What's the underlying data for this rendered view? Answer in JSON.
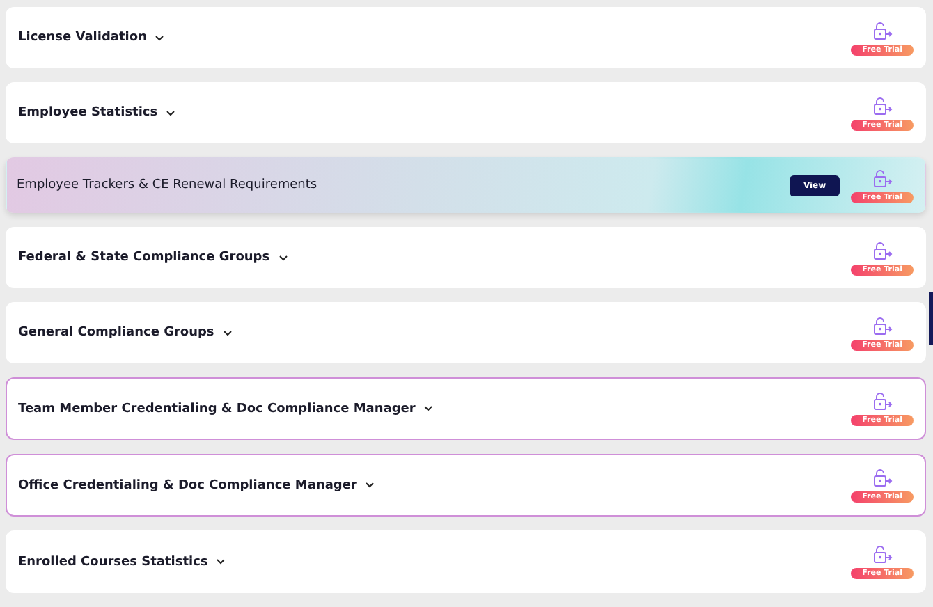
{
  "sections": [
    {
      "kind": "accordion",
      "title": "License Validation",
      "highlighted": false,
      "badge": "Free Trial"
    },
    {
      "kind": "accordion",
      "title": "Employee Statistics",
      "highlighted": false,
      "badge": "Free Trial"
    },
    {
      "kind": "banner",
      "title": "Employee Trackers & CE Renewal Requirements",
      "button": "View",
      "highlighted": false,
      "badge": "Free Trial"
    },
    {
      "kind": "accordion",
      "title": "Federal & State Compliance Groups",
      "highlighted": false,
      "badge": "Free Trial"
    },
    {
      "kind": "accordion",
      "title": "General Compliance Groups",
      "highlighted": false,
      "badge": "Free Trial"
    },
    {
      "kind": "accordion",
      "title": "Team Member Credentialing & Doc Compliance Manager",
      "highlighted": true,
      "badge": "Free Trial"
    },
    {
      "kind": "accordion",
      "title": "Office Credentialing & Doc Compliance Manager",
      "highlighted": true,
      "badge": "Free Trial"
    },
    {
      "kind": "accordion",
      "title": "Enrolled Courses Statistics",
      "highlighted": false,
      "badge": "Free Trial"
    }
  ]
}
